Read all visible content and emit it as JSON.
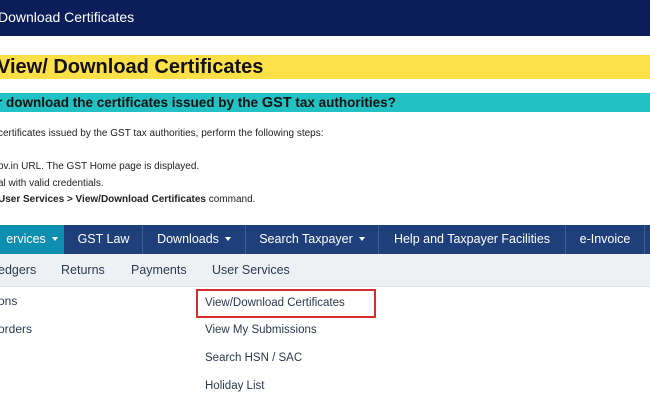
{
  "topbar": {
    "title": "Download Certificates"
  },
  "headings": {
    "main": "View/ Download Certificates",
    "question_pre": "r download the certificates issued by the ",
    "question_bold": "GST",
    "question_post": " tax authorities?"
  },
  "steps": {
    "intro": " certificates issued by the GST tax authorities, perform the following steps:",
    "step1": "ov.in URL. The GST Home page is displayed.",
    "step2": "al with valid credentials.",
    "step3_bold": "User Services > View/Download Certificates",
    "step3_post": " command."
  },
  "main_nav": {
    "services": "ervices",
    "gst_law": "GST Law",
    "downloads": "Downloads",
    "search_taxpayer": "Search Taxpayer",
    "help": "Help and Taxpayer Facilities",
    "einvoice": "e-Invoice"
  },
  "sub_nav": {
    "ledgers": "edgers",
    "returns": "Returns",
    "payments": "Payments",
    "user_services": "User Services"
  },
  "left_menu": {
    "item1": "ons",
    "item2": "orders"
  },
  "user_services_menu": {
    "view_download_certificates": "View/Download Certificates",
    "view_my_submissions": "View My Submissions",
    "search_hsn_sac": "Search HSN / SAC",
    "holiday_list": "Holiday List"
  },
  "colors": {
    "topbar": "#0b1e59",
    "heading_yellow": "#fde047",
    "heading_teal": "#22c1c3",
    "nav": "#1f3f7a",
    "nav_active": "#0f8fb0",
    "highlight": "#d32f2f"
  },
  "icons": {
    "dropdown": "caret-down-icon"
  }
}
